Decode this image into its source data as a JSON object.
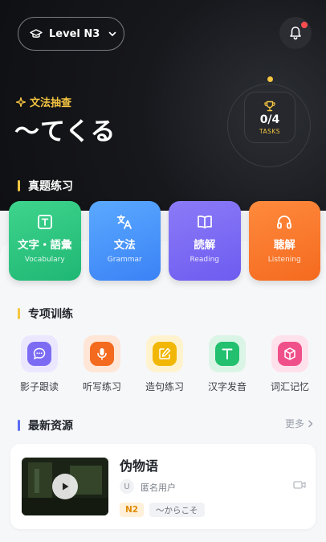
{
  "header": {
    "level_label": "Level N3"
  },
  "daily_grammar": {
    "kicker": "文法抽查",
    "headline": "～てくる",
    "tasks_count": "0/4",
    "tasks_label": "TASKS",
    "tasks_progress": 0
  },
  "exam_practice": {
    "title": "真题练习",
    "cards": [
      {
        "title": "文字・語彙",
        "subtitle": "Vocabulary",
        "color": "#22c07a",
        "icon": "text-box-icon"
      },
      {
        "title": "文法",
        "subtitle": "Grammar",
        "color": "#3b82f6",
        "icon": "translate-icon"
      },
      {
        "title": "読解",
        "subtitle": "Reading",
        "color": "#7363f3",
        "icon": "book-icon"
      },
      {
        "title": "聴解",
        "subtitle": "Listening",
        "color": "#f46a1f",
        "icon": "headphones-icon"
      }
    ]
  },
  "special_training": {
    "title": "专项训练",
    "items": [
      {
        "label": "影子跟读",
        "icon": "chat-bubble-icon",
        "color": "#7c6cf4"
      },
      {
        "label": "听写练习",
        "icon": "microphone-icon",
        "color": "#f46a1f"
      },
      {
        "label": "造句练习",
        "icon": "edit-icon",
        "color": "#f2b705"
      },
      {
        "label": "汉字发音",
        "icon": "letter-t-icon",
        "color": "#22c06f"
      },
      {
        "label": "词汇记忆",
        "icon": "cube-icon",
        "color": "#f0508a"
      }
    ]
  },
  "latest_resources": {
    "title": "最新资源",
    "more_label": "更多",
    "items": [
      {
        "title": "伪物语",
        "avatar_letter": "U",
        "author": "匿名用户",
        "level_tag": "N2",
        "grammar_tag": "～からこそ"
      }
    ]
  }
}
